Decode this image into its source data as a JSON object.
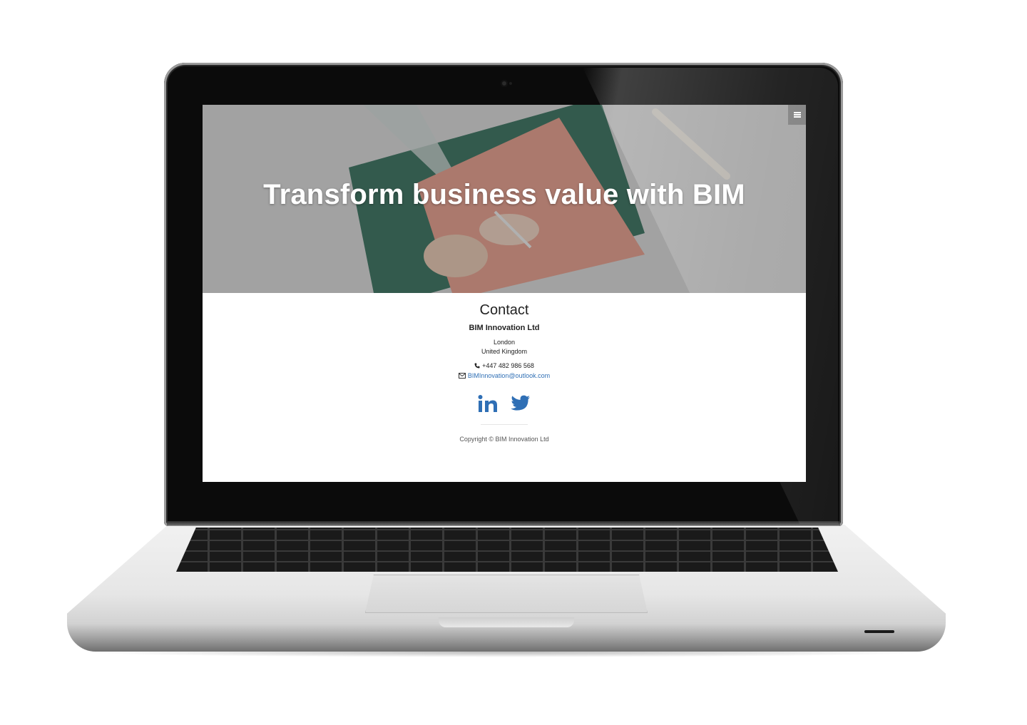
{
  "hero": {
    "title": "Transform business value with BIM",
    "menu_icon": "hamburger-icon"
  },
  "contact": {
    "heading": "Contact",
    "company": "BIM Innovation Ltd",
    "address": [
      "London",
      "United Kingdom"
    ],
    "phone": "+447 482 986 568",
    "phone_icon": "phone-icon",
    "email": "BIMInnovation@outlook.com",
    "email_icon": "envelope-icon",
    "social": [
      {
        "name": "linkedin-icon"
      },
      {
        "name": "twitter-icon"
      }
    ],
    "copyright": "Copyright © BIM Innovation Ltd"
  },
  "colors": {
    "link": "#2f6fb5",
    "social": "#2f6fb5",
    "hero_overlay": "#5a5a5a"
  }
}
